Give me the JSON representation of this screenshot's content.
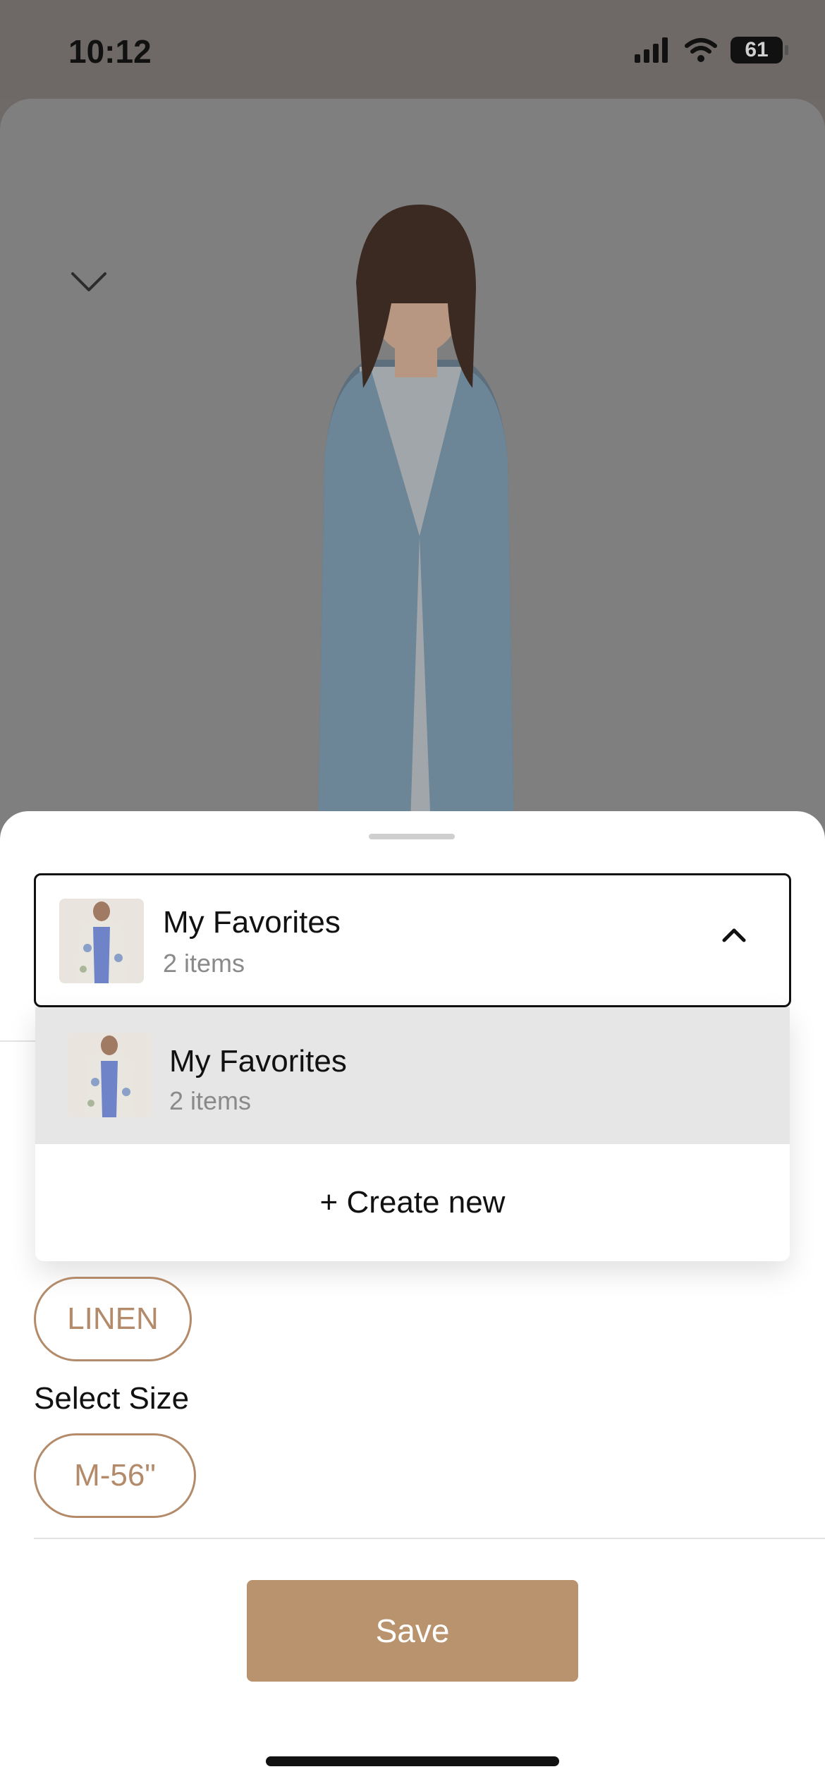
{
  "status_bar": {
    "time": "10:12",
    "battery": "61"
  },
  "collection_dropdown": {
    "selected_title": "My Favorites",
    "selected_count": "2 items",
    "options": [
      {
        "title": "My Favorites",
        "count": "2 items"
      }
    ],
    "create_new_label": "+ Create new"
  },
  "product_options": {
    "material_chip": "LINEN",
    "size_label": "Select Size",
    "size_chip": "M-56\""
  },
  "actions": {
    "save_label": "Save"
  },
  "colors": {
    "accent": "#b9926e",
    "chip_border": "#b38b6a",
    "overlay": "#7f7f7f"
  },
  "icons": [
    "chevron-down-icon",
    "chevron-up-icon",
    "cellular-signal-icon",
    "wifi-icon",
    "battery-icon"
  ]
}
